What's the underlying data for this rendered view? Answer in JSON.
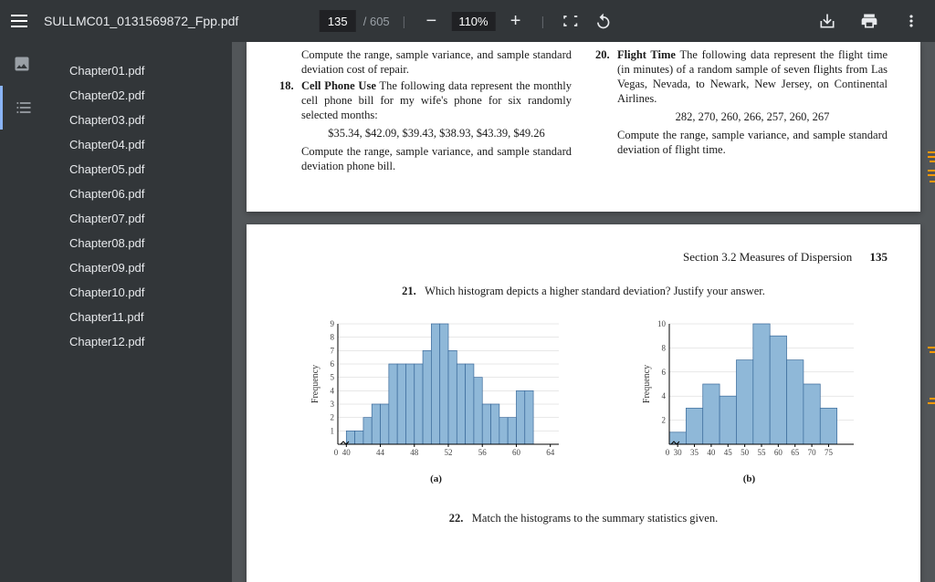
{
  "toolbar": {
    "filename": "SULLMC01_0131569872_Fpp.pdf",
    "current_page": "135",
    "total_pages": "/ 605",
    "zoom": "110%"
  },
  "sidebar": {
    "items": [
      {
        "label": "Chapter01.pdf"
      },
      {
        "label": "Chapter02.pdf"
      },
      {
        "label": "Chapter03.pdf"
      },
      {
        "label": "Chapter04.pdf"
      },
      {
        "label": "Chapter05.pdf"
      },
      {
        "label": "Chapter06.pdf"
      },
      {
        "label": "Chapter07.pdf"
      },
      {
        "label": "Chapter08.pdf"
      },
      {
        "label": "Chapter09.pdf"
      },
      {
        "label": "Chapter10.pdf"
      },
      {
        "label": "Chapter11.pdf"
      },
      {
        "label": "Chapter12.pdf"
      }
    ]
  },
  "page1": {
    "left_prev": "Compute the range, sample variance, and sample standard deviation cost of repair.",
    "p18_num": "18.",
    "p18_title": "Cell Phone Use",
    "p18_text": "  The following data represent the monthly cell phone bill for my wife's phone for six randomly selected months:",
    "p18_data": "$35.34, $42.09, $39.43, $38.93, $43.39, $49.26",
    "p18_compute": "Compute the range, sample variance, and sample standard deviation phone bill.",
    "p20_num": "20.",
    "p20_title": "Flight Time",
    "p20_text": "  The following data represent the flight time (in minutes) of a random sample of seven flights from Las Vegas, Nevada, to Newark, New Jersey, on Continental Airlines.",
    "p20_data": "282, 270, 260, 266, 257, 260, 267",
    "p20_compute": "Compute the range, sample variance, and sample standard deviation of flight time."
  },
  "page2": {
    "section": "Section 3.2    Measures of Dispersion",
    "page_num": "135",
    "q21_num": "21.",
    "q21_text": "Which histogram depicts a higher standard deviation? Justify your answer.",
    "q22_num": "22.",
    "q22_text": "Match the histograms to the summary statistics given.",
    "chart_a_label": "(a)",
    "chart_b_label": "(b)",
    "ylabel": "Frequency"
  },
  "chart_data": [
    {
      "type": "bar",
      "id": "a",
      "xlabel": "",
      "ylabel": "Frequency",
      "x_ticks": [
        0,
        40,
        44,
        48,
        52,
        56,
        60,
        64
      ],
      "y_ticks": [
        1,
        2,
        3,
        4,
        5,
        6,
        7,
        8,
        9
      ],
      "ylim": [
        0,
        9
      ],
      "bars": [
        {
          "x": 40,
          "h": 1
        },
        {
          "x": 41,
          "h": 1
        },
        {
          "x": 42,
          "h": 2
        },
        {
          "x": 43,
          "h": 3
        },
        {
          "x": 44,
          "h": 3
        },
        {
          "x": 45,
          "h": 6
        },
        {
          "x": 46,
          "h": 6
        },
        {
          "x": 47,
          "h": 6
        },
        {
          "x": 48,
          "h": 6
        },
        {
          "x": 49,
          "h": 7
        },
        {
          "x": 50,
          "h": 9
        },
        {
          "x": 51,
          "h": 9
        },
        {
          "x": 52,
          "h": 7
        },
        {
          "x": 53,
          "h": 6
        },
        {
          "x": 54,
          "h": 6
        },
        {
          "x": 55,
          "h": 5
        },
        {
          "x": 56,
          "h": 3
        },
        {
          "x": 57,
          "h": 3
        },
        {
          "x": 58,
          "h": 2
        },
        {
          "x": 59,
          "h": 2
        },
        {
          "x": 60,
          "h": 4
        },
        {
          "x": 61,
          "h": 4
        }
      ]
    },
    {
      "type": "bar",
      "id": "b",
      "xlabel": "",
      "ylabel": "Frequency",
      "x_ticks": [
        0,
        30,
        35,
        40,
        45,
        50,
        55,
        60,
        65,
        70,
        75
      ],
      "y_ticks": [
        2,
        4,
        6,
        8,
        10
      ],
      "ylim": [
        0,
        10
      ],
      "bars": [
        {
          "x": 30,
          "h": 1
        },
        {
          "x": 35,
          "h": 3
        },
        {
          "x": 40,
          "h": 5
        },
        {
          "x": 45,
          "h": 4
        },
        {
          "x": 50,
          "h": 7
        },
        {
          "x": 55,
          "h": 10
        },
        {
          "x": 60,
          "h": 9
        },
        {
          "x": 65,
          "h": 7
        },
        {
          "x": 70,
          "h": 5
        },
        {
          "x": 75,
          "h": 3
        }
      ]
    }
  ]
}
